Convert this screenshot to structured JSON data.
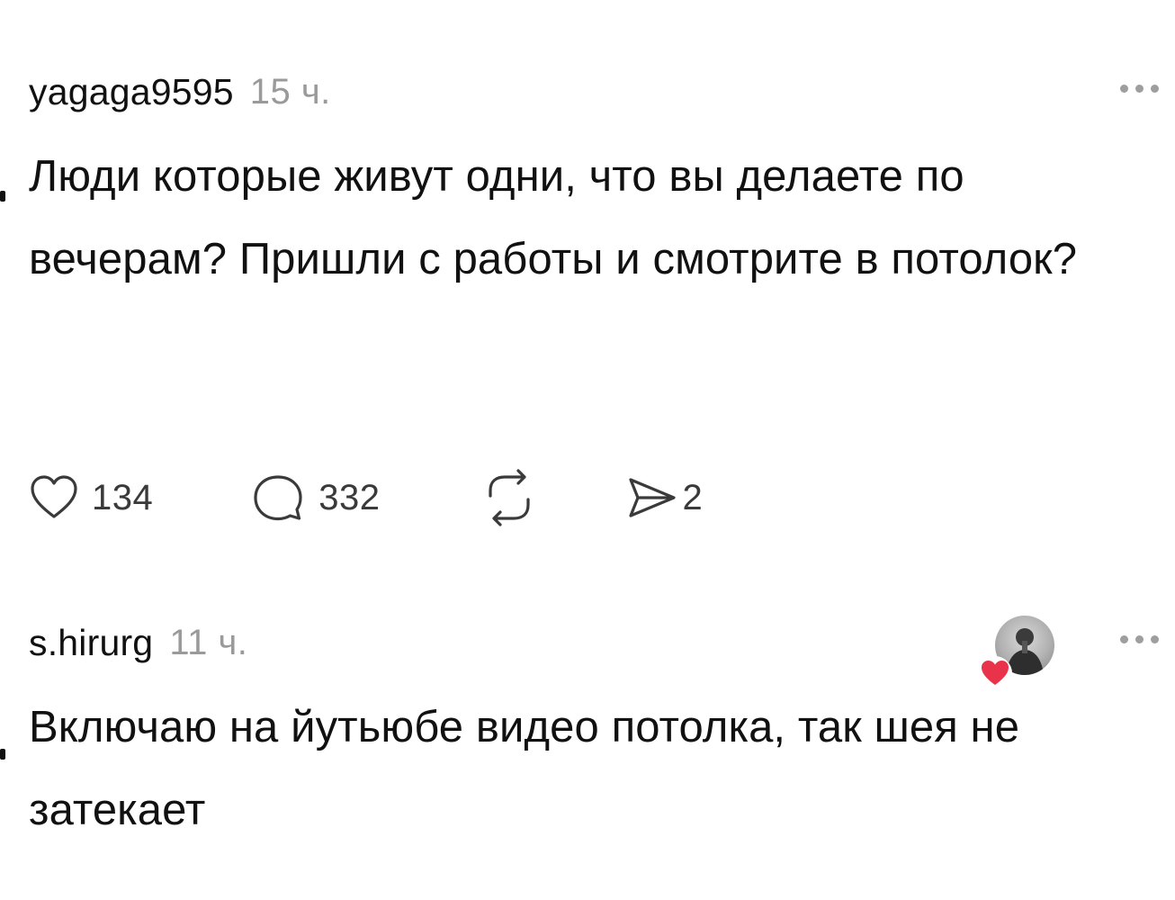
{
  "posts": [
    {
      "username": "yagaga9595",
      "time": "15 ч.",
      "text": "Люди которые живут одни, что вы делаете по вечерам? Пришли с работы и смотрите в потолок?",
      "actions": {
        "likes": "134",
        "comments": "332",
        "shares": "2"
      },
      "icons": [
        "heart-icon",
        "comment-icon",
        "repost-icon",
        "send-icon",
        "more-icon"
      ]
    },
    {
      "username": "s.hirurg",
      "time": "11 ч.",
      "text": "Включаю на йутьюбе видео потолка, так шея не затекает",
      "icons": [
        "avatar",
        "liked-heart-icon",
        "more-icon"
      ]
    }
  ],
  "colors": {
    "text": "#111111",
    "muted": "#9a9a9a",
    "icon": "#3a3a3a",
    "heart_badge": "#e8334a"
  }
}
